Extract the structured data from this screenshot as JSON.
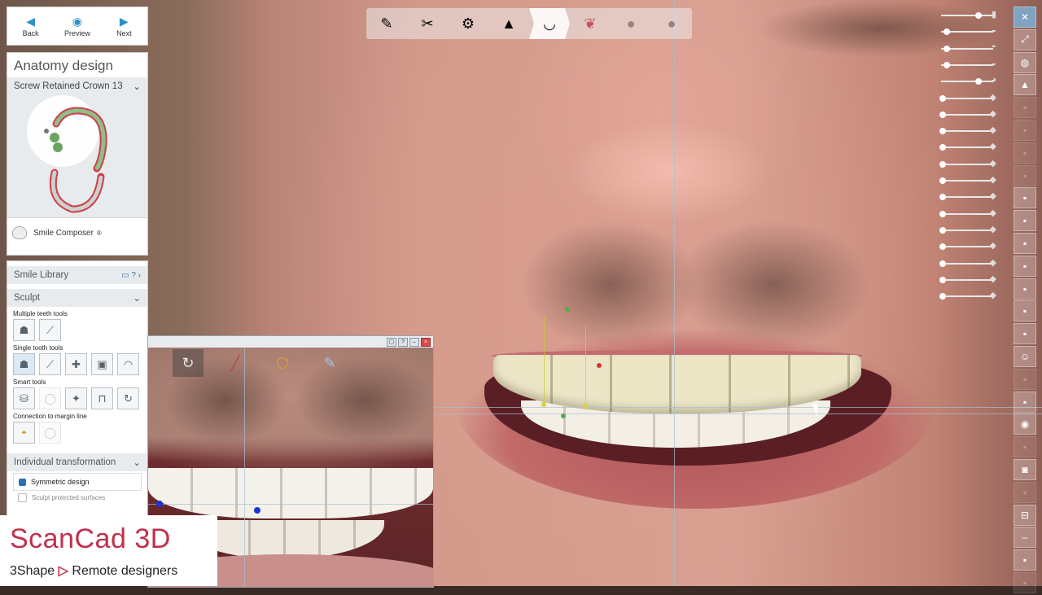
{
  "nav": {
    "back_label": "Back",
    "preview_label": "Preview",
    "next_label": "Next",
    "back_icon": "arrow-left-icon",
    "preview_icon": "eye-icon",
    "next_icon": "arrow-right-icon"
  },
  "anatomy": {
    "title": "Anatomy design",
    "restoration": "Screw Retained Crown 13",
    "smile_composer_label": "Smile Composer",
    "smile_composer_mark": "®"
  },
  "sculpt_panel": {
    "smile_library_label": "Smile Library",
    "smile_library_help": "?",
    "sculpt_label": "Sculpt",
    "groups": [
      {
        "label": "Multiple teeth tools",
        "tools": [
          "multi-teeth-sculpt",
          "multi-teeth-smooth"
        ]
      },
      {
        "label": "Single tooth tools",
        "tools": [
          "single-tooth-sculpt",
          "single-tooth-smooth",
          "add-material",
          "remove-material",
          "flatten"
        ]
      },
      {
        "label": "Smart tools",
        "tools": [
          "smart-shape",
          "smart-contact",
          "smart-morph",
          "smart-crop",
          "smart-rotate"
        ]
      },
      {
        "label": "Connection to margin line",
        "tools": [
          "margin-connect",
          "margin-disconnect"
        ]
      }
    ],
    "individual_transformation_label": "Individual transformation",
    "symmetric_design_label": "Symmetric design",
    "symmetric_design_checked": true,
    "sculpt_protected_label": "Sculpt protected surfaces",
    "sculpt_protected_checked": false
  },
  "inset_window": {
    "controls": [
      "restore",
      "help",
      "minimize",
      "close"
    ],
    "tools": [
      "rotate-icon",
      "line-icon",
      "points-icon",
      "brush-icon"
    ]
  },
  "top_toolbar": {
    "steps": [
      "margin-step",
      "scissors-step",
      "abutment-step",
      "cap-step",
      "anatomy-step",
      "gingiva-step",
      "connector-step",
      "finish-step"
    ],
    "active_index": 4
  },
  "visibility_sliders": [
    {
      "icon": "model-icon",
      "level": 0.85
    },
    {
      "icon": "antagonist-icon",
      "level": 0.1
    },
    {
      "icon": "gingiva-icon",
      "level": 0.1
    },
    {
      "icon": "scan-icon",
      "level": 0.1
    },
    {
      "icon": "crown-icon",
      "level": 0.85
    },
    {
      "icon": "cap-icon",
      "level": 0.0
    },
    {
      "icon": "cut-icon",
      "level": 0.0
    },
    {
      "icon": "tooth-icon",
      "level": 0.0
    },
    {
      "icon": "prep-icon",
      "level": 0.0
    },
    {
      "icon": "library-tooth-icon",
      "level": 0.0
    },
    {
      "icon": "smile-icon",
      "level": 0.0
    },
    {
      "icon": "face-icon",
      "level": 0.0
    },
    {
      "icon": "implant-icon",
      "level": 0.0
    },
    {
      "icon": "screw-icon",
      "level": 0.0
    },
    {
      "icon": "analog-icon",
      "level": 0.0
    },
    {
      "icon": "green-abutment-icon",
      "level": 0.0
    },
    {
      "icon": "driver-icon",
      "level": 0.0
    },
    {
      "icon": "pin-icon",
      "level": 0.0
    }
  ],
  "right_toolbar": [
    {
      "icon": "close-icon"
    },
    {
      "icon": "fullscreen-icon"
    },
    {
      "icon": "globe-icon"
    },
    {
      "icon": "graduation-icon"
    },
    {
      "icon": "copy-icon"
    },
    {
      "icon": "paste-icon"
    },
    {
      "icon": "page-icon"
    },
    {
      "icon": "layer-icon"
    },
    {
      "icon": "scan-brush-icon"
    },
    {
      "icon": "ruler-icon"
    },
    {
      "icon": "ruler2-icon"
    },
    {
      "icon": "section-icon"
    },
    {
      "icon": "tooth-view-icon"
    },
    {
      "icon": "abutment-view-icon"
    },
    {
      "icon": "frame-icon"
    },
    {
      "icon": "face-view-icon"
    },
    {
      "icon": "blank-icon"
    },
    {
      "icon": "panel-icon"
    },
    {
      "icon": "sphere-icon"
    },
    {
      "icon": "blank2-icon"
    },
    {
      "icon": "camera-icon"
    },
    {
      "icon": "blank3-icon"
    },
    {
      "icon": "split-icon"
    },
    {
      "icon": "minus-icon"
    },
    {
      "icon": "snapshot-icon"
    },
    {
      "icon": "blank4-icon"
    }
  ],
  "watermark": {
    "brand": "ScanCad 3D",
    "tag_left": "3Shape",
    "tag_right": "Remote designers"
  }
}
